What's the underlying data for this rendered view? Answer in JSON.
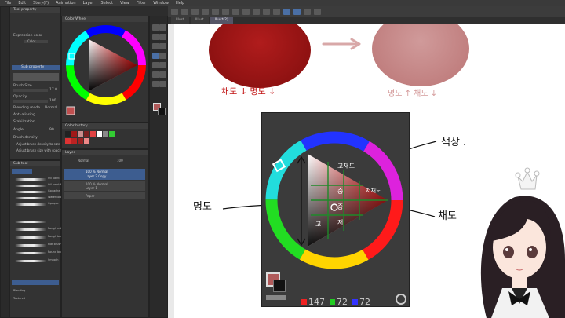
{
  "menu": {
    "items": [
      "File",
      "Edit",
      "Story(F)",
      "Animation",
      "Layer",
      "Select",
      "View",
      "Filter",
      "Window",
      "Help"
    ]
  },
  "canvas_tabs": [
    "Illust",
    "Illust",
    "Illust(2)"
  ],
  "panels": {
    "tool_property_title": "Tool property",
    "expression_color_label": "Expression color",
    "expression_color_value": "Color",
    "sub_property_title": "Sub property",
    "brush_size_label": "Brush Size",
    "brush_size_value": "17.0",
    "opacity_label": "Opacity",
    "opacity_value": "100",
    "blending_label": "Blending mode",
    "blending_value": "Normal",
    "anti_aliasing_label": "Anti-aliasing",
    "stabilization_label": "Stabilization",
    "angle_label": "Angle",
    "angle_value": "90",
    "brush_density_label": "Brush density",
    "adjust_size_label": "Adjust brush density to size",
    "adjust_spacing_label": "Adjust brush size with spacing",
    "subtool_title": "Sub tool",
    "color_wheel_title": "Color Wheel",
    "color_history_title": "Color history",
    "layer_title": "Layer",
    "layer_blend_value": "Normal",
    "layer_opacity_value": "100",
    "layers": [
      {
        "name": "100 % Normal",
        "sub": "Layer 2 Copy"
      },
      {
        "name": "100 % Normal",
        "sub": "Layer 1"
      },
      {
        "name": "Paper",
        "sub": ""
      }
    ],
    "subtools": [
      "Oil paint",
      "Oil paint flat",
      "Gouache",
      "Watercolor",
      "Opaque",
      "Thick paint",
      "Rough edge"
    ],
    "subtools2": [
      "Rough brush",
      "Flat brush",
      "Round brush",
      "Smooth",
      "Blending",
      "Textured"
    ]
  },
  "annotations": {
    "left_label": "채도 ↓ 명도 ↓",
    "right_label": "명도 ↑ 채도 ↓",
    "hue_label": "색상 .",
    "saturation_label": "채도",
    "value_label": "명도",
    "cell_top": "고채도",
    "cell_right": "저채도",
    "cell_mid_left": "중",
    "cell_mid": "중",
    "cell_low": "저",
    "cell_low2": "고"
  },
  "color_values": {
    "red": "147",
    "green": "72",
    "blue": "72"
  },
  "colors": {
    "red_blob": "#a01818",
    "pink_blob": "#c98d8d",
    "fg_color": "#b05a5a"
  },
  "icons": [
    "arrow-right-icon",
    "hand-icon",
    "pen-icon",
    "eraser-icon",
    "brush-icon",
    "eyedropper-icon",
    "fill-icon",
    "text-icon",
    "move-icon",
    "color-wheel-mode-icon"
  ]
}
